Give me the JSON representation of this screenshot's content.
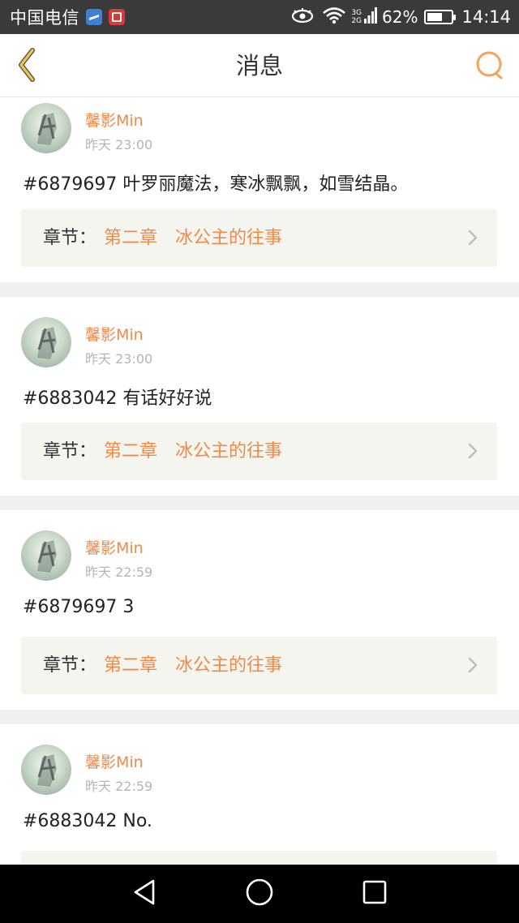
{
  "status_bar": {
    "carrier": "中国电信",
    "app_icons": [
      "health-app-icon",
      "news-app-icon"
    ],
    "network_top": "3G",
    "network_bottom": "2G",
    "battery_percent": "62%",
    "battery_level": 0.62,
    "time": "14:14",
    "icons": [
      "eye-icon",
      "wifi-icon",
      "signal-icon",
      "battery-icon"
    ]
  },
  "header": {
    "title": "消息",
    "back_icon": "chevron-left-icon",
    "search_icon": "search-icon"
  },
  "colors": {
    "accent": "#f08a4b",
    "back_icon": "#f5c542",
    "chapter_bg": "#f5f5ef",
    "separator": "#f0f0f0"
  },
  "messages": [
    {
      "username": "馨影Min",
      "timestamp": "昨天 23:00",
      "text": "#6879697 叶罗丽魔法，寒冰飘飘，如雪结晶。",
      "chapter_label": "章节：",
      "chapter_title": "第二章　冰公主的往事"
    },
    {
      "username": "馨影Min",
      "timestamp": "昨天 23:00",
      "text": "#6883042 有话好好说",
      "chapter_label": "章节：",
      "chapter_title": "第二章　冰公主的往事"
    },
    {
      "username": "馨影Min",
      "timestamp": "昨天 22:59",
      "text": "#6879697 3",
      "chapter_label": "章节：",
      "chapter_title": "第二章　冰公主的往事"
    },
    {
      "username": "馨影Min",
      "timestamp": "昨天 22:59",
      "text": "#6883042 No."
    }
  ],
  "nav_bar": {
    "icons": [
      "back-triangle-icon",
      "home-circle-icon",
      "recents-square-icon"
    ]
  }
}
